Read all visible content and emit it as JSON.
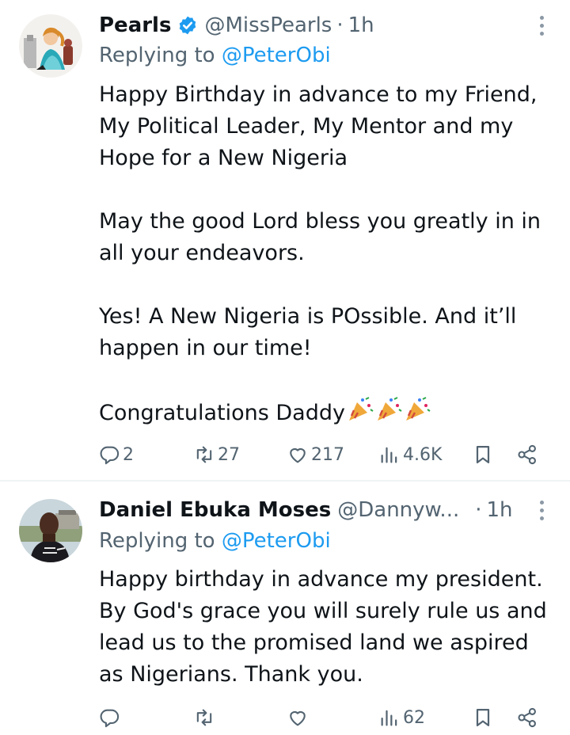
{
  "tweets": [
    {
      "name": "Pearls",
      "handle": "@MissPearls",
      "time": "1h",
      "replying_prefix": "Replying to",
      "replying_handle": "@PeterObi",
      "verified": true,
      "body": [
        "Happy Birthday in advance to my Friend,",
        "My Political Leader, My Mentor and my",
        "Hope for a New Nigeria",
        "",
        "May the good Lord bless you greatly in in",
        "all your endeavors.",
        "",
        "Yes! A New Nigeria is POssible. And it’ll",
        "happen in our time!",
        "",
        "Congratulations Daddy"
      ],
      "emoji": "party-popper x3",
      "stats": {
        "replies": "2",
        "reposts": "27",
        "likes": "217",
        "views": "4.6K"
      }
    },
    {
      "name": "Daniel Ebuka Moses",
      "handle": "@Dannyw...",
      "time": "1h",
      "replying_prefix": "Replying to",
      "replying_handle": "@PeterObi",
      "verified": false,
      "body": [
        "Happy birthday in advance my president.",
        "By God's grace you will surely rule us and",
        "lead us to the promised land we aspired",
        "as Nigerians. Thank you."
      ],
      "stats": {
        "replies": "",
        "reposts": "",
        "likes": "",
        "views": "62"
      }
    }
  ],
  "colors": {
    "text": "#0f1419",
    "secondary": "#536471",
    "link": "#1d9bf0",
    "verified": "#1d9bf0",
    "divider": "#eff3f4"
  },
  "icons": [
    "reply-icon",
    "repost-icon",
    "like-icon",
    "views-icon",
    "bookmark-icon",
    "share-icon",
    "more-icon",
    "verified-icon",
    "party-popper-icon"
  ]
}
